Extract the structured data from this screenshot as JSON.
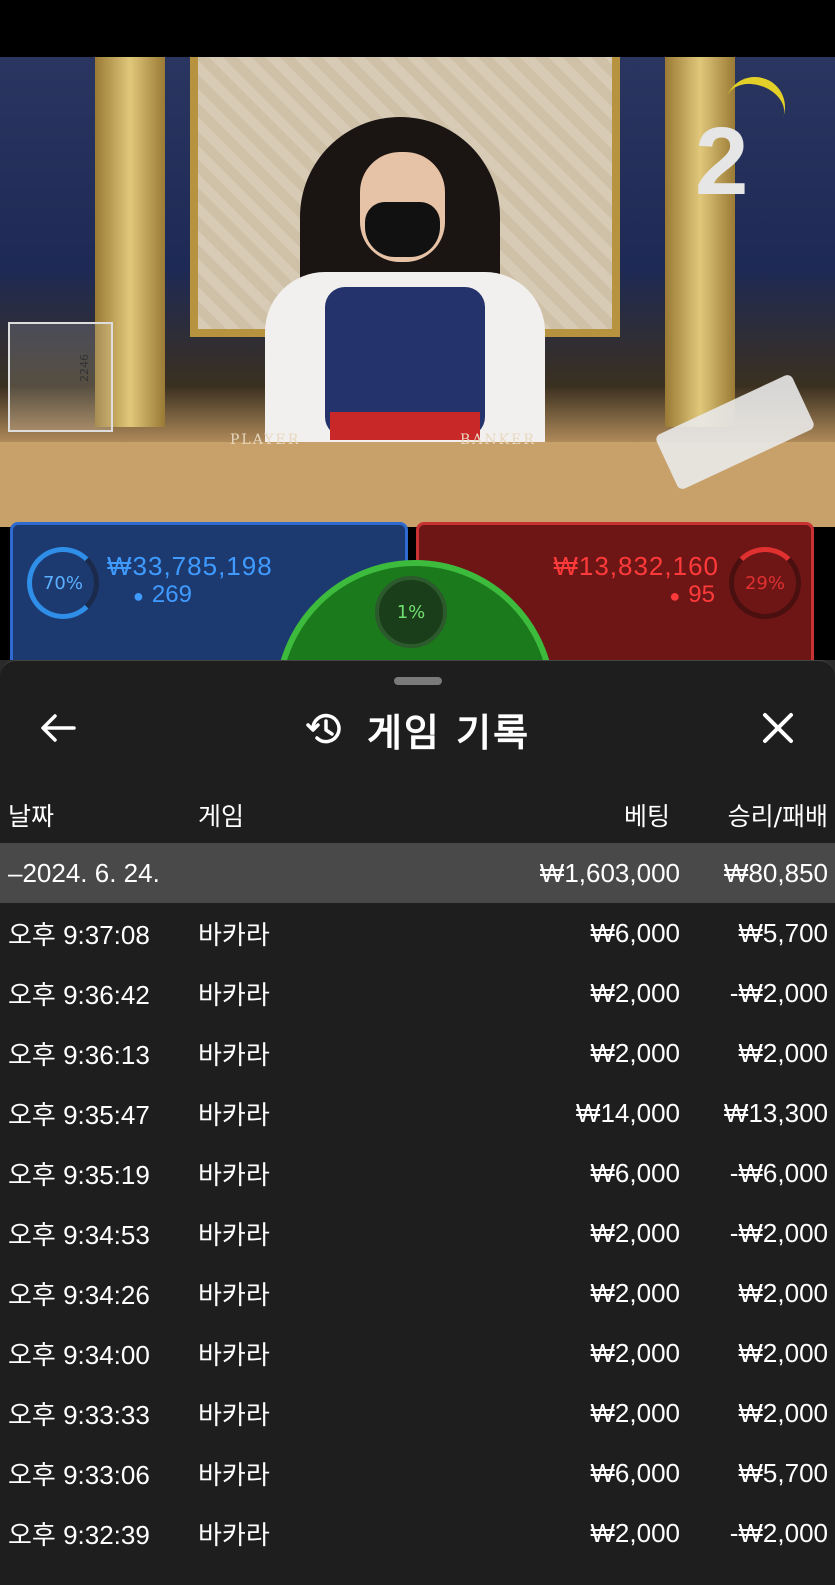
{
  "video": {
    "round_number": "2",
    "table_labels": {
      "player": "PLAYER",
      "banker": "BANKER"
    },
    "discard_label": "2246"
  },
  "bets": {
    "player": {
      "percent": "70%",
      "amount": "₩33,785,198",
      "players": "269",
      "color": "#2f6ad0"
    },
    "banker": {
      "percent": "29%",
      "amount": "₩13,832,160",
      "players": "95",
      "color": "#c83232"
    },
    "tie": {
      "percent": "1%",
      "color": "#3dbb3d"
    }
  },
  "history": {
    "title": "게임 기록",
    "icons": {
      "back": "arrow-left-icon",
      "title": "history-clock-icon",
      "close": "close-icon"
    },
    "columns": {
      "date": "날짜",
      "game": "게임",
      "bet": "베팅",
      "result": "승리/패배"
    },
    "day_summary": {
      "date": "–2024. 6. 24.",
      "bet": "₩1,603,000",
      "result": "₩80,850"
    },
    "rows": [
      {
        "time": "오후 9:37:08",
        "game": "바카라",
        "bet": "₩6,000",
        "result": "₩5,700"
      },
      {
        "time": "오후 9:36:42",
        "game": "바카라",
        "bet": "₩2,000",
        "result": "-₩2,000"
      },
      {
        "time": "오후 9:36:13",
        "game": "바카라",
        "bet": "₩2,000",
        "result": "₩2,000"
      },
      {
        "time": "오후 9:35:47",
        "game": "바카라",
        "bet": "₩14,000",
        "result": "₩13,300"
      },
      {
        "time": "오후 9:35:19",
        "game": "바카라",
        "bet": "₩6,000",
        "result": "-₩6,000"
      },
      {
        "time": "오후 9:34:53",
        "game": "바카라",
        "bet": "₩2,000",
        "result": "-₩2,000"
      },
      {
        "time": "오후 9:34:26",
        "game": "바카라",
        "bet": "₩2,000",
        "result": "₩2,000"
      },
      {
        "time": "오후 9:34:00",
        "game": "바카라",
        "bet": "₩2,000",
        "result": "₩2,000"
      },
      {
        "time": "오후 9:33:33",
        "game": "바카라",
        "bet": "₩2,000",
        "result": "₩2,000"
      },
      {
        "time": "오후 9:33:06",
        "game": "바카라",
        "bet": "₩6,000",
        "result": "₩5,700"
      },
      {
        "time": "오후 9:32:39",
        "game": "바카라",
        "bet": "₩2,000",
        "result": "-₩2,000"
      }
    ]
  }
}
